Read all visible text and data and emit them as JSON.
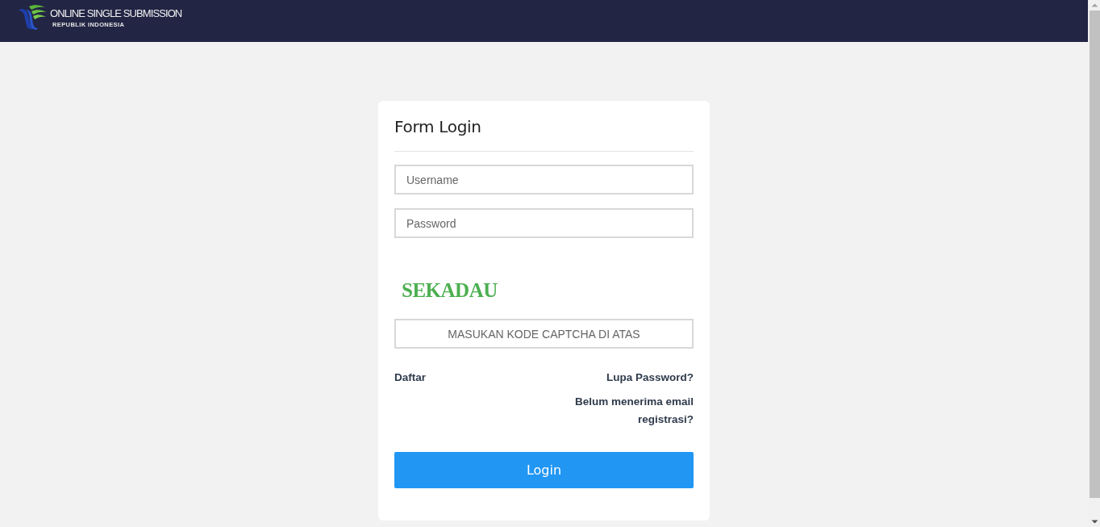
{
  "header": {
    "title": "ONLINE SINGLE SUBMISSION",
    "subtitle": "REPUBLIK INDONESIA"
  },
  "login_form": {
    "title": "Form Login",
    "fields": [
      {
        "placeholder": "Username"
      },
      {
        "placeholder": "Password"
      }
    ],
    "captcha": {
      "code": "SEKADAU",
      "placeholder": "MASUKAN KODE CAPTCHA DI ATAS"
    },
    "links": {
      "register": "Daftar",
      "forgot_password": "Lupa Password?",
      "resend_email": "Belum menerima email registrasi?"
    },
    "submit_button": "Login"
  }
}
